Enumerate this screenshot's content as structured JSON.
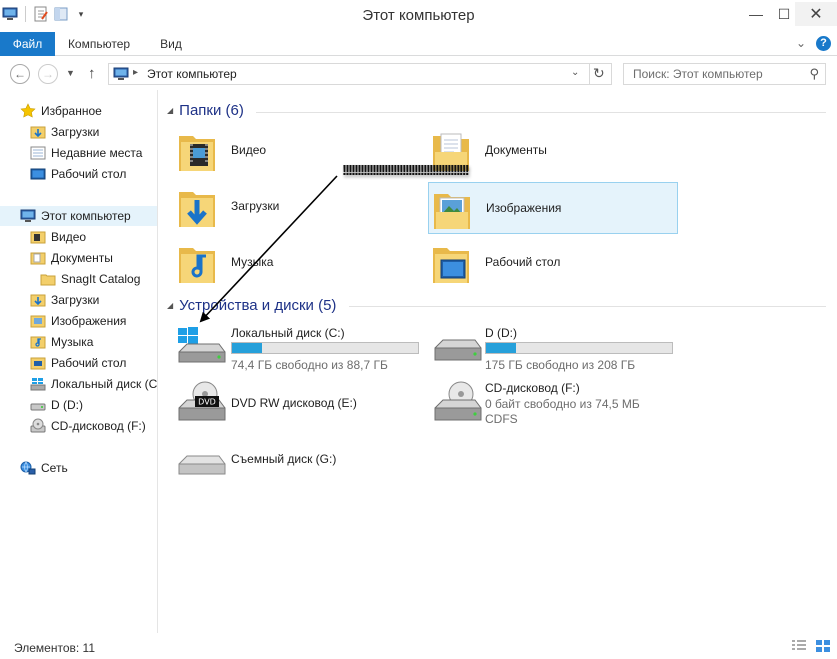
{
  "window": {
    "title": "Этот компьютер"
  },
  "ribbon": {
    "tabs": [
      "Файл",
      "Компьютер",
      "Вид"
    ]
  },
  "address": {
    "path": "Этот компьютер",
    "search_placeholder": "Поиск: Этот компьютер"
  },
  "nav": {
    "favorites": {
      "label": "Избранное",
      "items": [
        "Загрузки",
        "Недавние места",
        "Рабочий стол"
      ]
    },
    "computer": {
      "label": "Этот компьютер",
      "items": [
        "Видео",
        "Документы",
        "SnagIt Catalog",
        "Загрузки",
        "Изображения",
        "Музыка",
        "Рабочий стол",
        "Локальный диск (C:)",
        "D (D:)",
        "CD-дисковод (F:)"
      ]
    },
    "network": {
      "label": "Сеть"
    }
  },
  "folders": {
    "heading": "Папки (6)",
    "items": [
      "Видео",
      "Документы",
      "Загрузки",
      "Изображения",
      "Музыка",
      "Рабочий стол"
    ]
  },
  "devices": {
    "heading": "Устройства и диски (5)",
    "drives": [
      {
        "name": "Локальный диск (C:)",
        "free": "74,4 ГБ свободно из 88,7 ГБ",
        "used_fraction": 0.16
      },
      {
        "name": "D (D:)",
        "free": "175 ГБ свободно из 208 ГБ",
        "used_fraction": 0.16
      },
      {
        "name": "DVD RW дисковод (E:)"
      },
      {
        "name": "CD-дисковод (F:)",
        "free": "0 байт свободно из 74,5 МБ",
        "fs": "CDFS"
      },
      {
        "name": "Съемный диск (G:)"
      }
    ]
  },
  "annotation": {
    "text": "!!!!!!!!!!!!!!!!!!!!!!!!!!!!!!!!!!!!!!!!!!"
  },
  "status": {
    "count": "Элементов: 11"
  },
  "colors": {
    "accent": "#1979ca",
    "selection": "#e5f3fb",
    "bar_fill": "#26a0da",
    "heading": "#1e3287"
  },
  "icons": {
    "qat": [
      "computer-icon",
      "properties-icon",
      "new-folder-icon",
      "customize-qat-icon"
    ],
    "nav": [
      "star-icon",
      "folder-download-icon",
      "recent-places-icon",
      "desktop-icon",
      "computer-icon",
      "network-icon"
    ]
  }
}
